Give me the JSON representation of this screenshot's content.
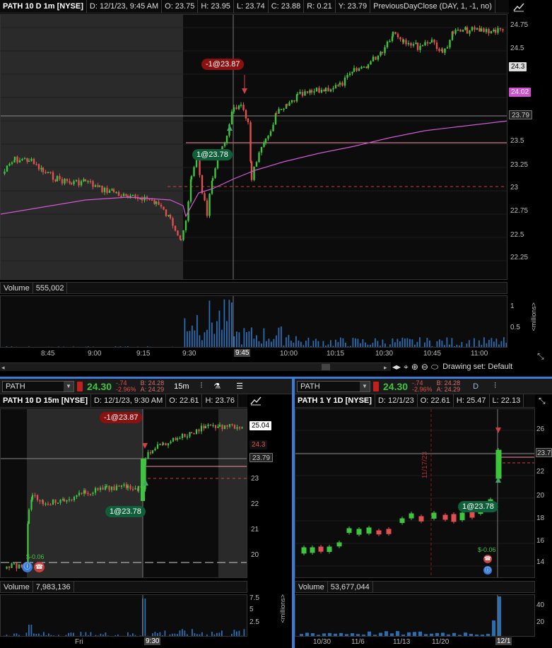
{
  "main": {
    "header": {
      "title": "PATH 10 D 1m [NYSE]",
      "date": "D: 12/1/23, 9:45 AM",
      "open": "O: 23.75",
      "high": "H: 23.95",
      "low": "L: 23.74",
      "close": "C: 23.88",
      "range": "R: 0.21",
      "y": "Y: 23.79",
      "study": "PreviousDayClose (DAY, 1, -1, no)"
    },
    "price_ticks": [
      "24.75",
      "24.5",
      "23.5",
      "23.25",
      "23",
      "22.75",
      "22.5",
      "22.25"
    ],
    "price_tags": {
      "t1": "24.3",
      "t2": "24.02",
      "t3": "23.79"
    },
    "trade_sell": "-1@23.87",
    "trade_buy": "1@23.78",
    "volume_label": "Volume",
    "volume_value": "555,002",
    "volume_ticks": [
      "1",
      "0.5"
    ],
    "volume_unit": "<millions>",
    "time_ticks": [
      "8:45",
      "9:00",
      "9:15",
      "9:30",
      "9:45",
      "10:00",
      "10:15",
      "10:30",
      "10:45",
      "11:00"
    ],
    "drawing_set": "Drawing set: Default"
  },
  "left": {
    "symbol": "PATH",
    "last": "24.30",
    "change": "-.74",
    "change_pct": "-2.96%",
    "bid": "B: 24.28",
    "ask": "A: 24.29",
    "aggregation": "15m",
    "header": {
      "title": "PATH 10 D 15m [NYSE]",
      "date": "D: 12/1/23, 9:30 AM",
      "open": "O: 22.61",
      "high": "H: 23.76"
    },
    "price_ticks": [
      "23",
      "22",
      "21",
      "20"
    ],
    "price_tags": {
      "t1": "25.04",
      "t2": "24.3",
      "t3": "23.79"
    },
    "trade_sell": "-1@23.87",
    "trade_buy": "1@23.78",
    "dividend": "$-0.06",
    "volume_label": "Volume",
    "volume_value": "7,983,136",
    "volume_ticks": [
      "7.5",
      "5",
      "2.5"
    ],
    "volume_unit": "<millions>",
    "time_ticks": [
      "Fri",
      "9:30"
    ]
  },
  "right": {
    "symbol": "PATH",
    "last": "24.30",
    "change": "-.74",
    "change_pct": "-2.96%",
    "bid": "B: 24.28",
    "ask": "A: 24.29",
    "aggregation": "D",
    "header": {
      "title": "PATH 1 Y 1D [NYSE]",
      "date": "D: 12/1/23",
      "open": "O: 22.61",
      "high": "H: 25.47",
      "low": "L: 22.13"
    },
    "price_ticks": [
      "26",
      "24",
      "22",
      "20",
      "18",
      "16",
      "14"
    ],
    "price_tag": "23.7",
    "trade_buy": "1@23.78",
    "dividend": "$-0.06",
    "vline_label": "11/17/23",
    "volume_label": "Volume",
    "volume_value": "53,677,044",
    "volume_ticks": [
      "40",
      "20"
    ],
    "time_ticks": [
      "10/30",
      "11/6",
      "11/13",
      "11/20",
      "12/1"
    ]
  },
  "colors": {
    "up": "#3ec53e",
    "down": "#e05050",
    "vwap": "#d05ad0",
    "pink_line": "#ff8fa3"
  }
}
